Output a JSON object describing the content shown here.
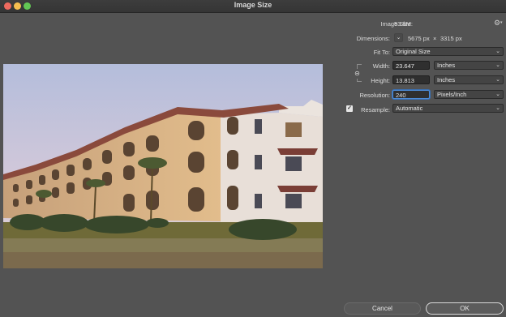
{
  "window": {
    "title": "Image Size"
  },
  "info": {
    "image_size_label": "Image Size:",
    "image_size_value": "53.8M"
  },
  "dimensions": {
    "label": "Dimensions:",
    "width": "5675 px",
    "times": "×",
    "height": "3315 px"
  },
  "fit_to": {
    "label": "Fit To:",
    "value": "Original Size"
  },
  "width": {
    "label": "Width:",
    "value": "23.647",
    "unit": "Inches"
  },
  "height": {
    "label": "Height:",
    "value": "13.813",
    "unit": "Inches"
  },
  "resolution": {
    "label": "Resolution:",
    "value": "240",
    "unit": "Pixels/Inch"
  },
  "resample": {
    "label": "Resample:",
    "checked": true,
    "value": "Automatic"
  },
  "buttons": {
    "cancel": "Cancel",
    "ok": "OK"
  }
}
